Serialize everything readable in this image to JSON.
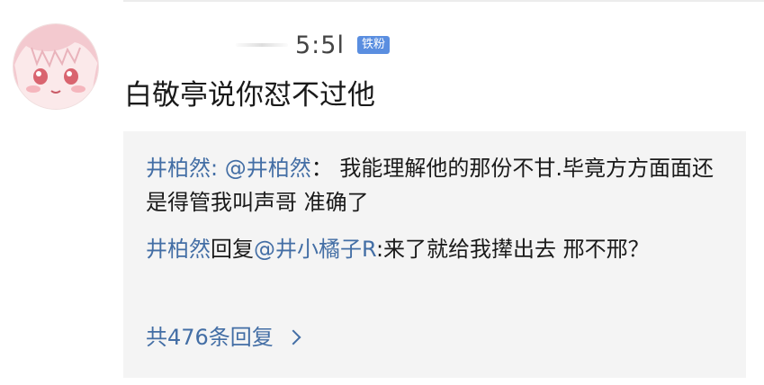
{
  "comment": {
    "username": "5:5l",
    "badge": "铁粉",
    "text": "白敬亭说你怼不过他"
  },
  "replies": [
    {
      "author": "井柏然",
      "separator": ": ",
      "mention": "@井柏然",
      "body": "： 我能理解他的那份不甘.毕竟方方面面还是得管我叫声哥 准确了"
    },
    {
      "author": "井柏然",
      "verb": "回复",
      "mention": "@井小橘子R",
      "body": ":来了就给我撵出去 邢不邢？"
    }
  ],
  "total_replies_label": "共476条回复",
  "colors": {
    "link_blue": "#436ea5",
    "badge_blue": "#5a8ee0",
    "reply_background": "#f4f4f4"
  }
}
